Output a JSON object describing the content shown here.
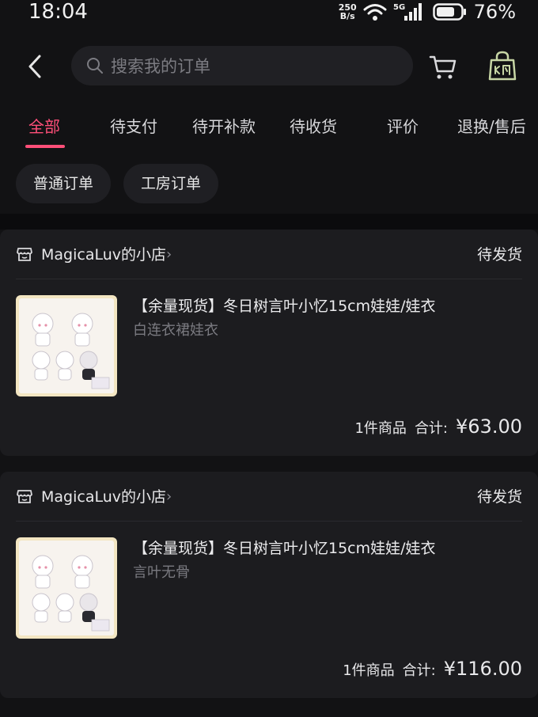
{
  "status_bar": {
    "time": "18:04",
    "net_speed_value": "250",
    "net_speed_unit": "B/s",
    "network_type": "5G",
    "battery_percent": "76%"
  },
  "header": {
    "search_placeholder": "搜索我的订单"
  },
  "tabs": [
    {
      "label": "全部",
      "active": true
    },
    {
      "label": "待支付",
      "active": false
    },
    {
      "label": "待开补款",
      "active": false
    },
    {
      "label": "待收货",
      "active": false
    },
    {
      "label": "评价",
      "active": false
    },
    {
      "label": "退换/售后",
      "active": false
    }
  ],
  "filters": [
    {
      "label": "普通订单"
    },
    {
      "label": "工房订单"
    }
  ],
  "orders": [
    {
      "shop_name": "MagicaLuv的小店",
      "status": "待发货",
      "product_title": "【余量现货】冬日树言叶小忆15cm娃娃/娃衣",
      "product_variant": "白连衣裙娃衣",
      "item_count": "1件商品",
      "total_label": "合计:",
      "total_amount": "¥63.00"
    },
    {
      "shop_name": "MagicaLuv的小店",
      "status": "待发货",
      "product_title": "【余量现货】冬日树言叶小忆15cm娃娃/娃衣",
      "product_variant": "言叶无骨",
      "item_count": "1件商品",
      "total_label": "合计:",
      "total_amount": "¥116.00"
    }
  ],
  "colors": {
    "background": "#121214",
    "card": "#1c1c1f",
    "accent": "#ff4f79",
    "muted_text": "#7a7a80"
  },
  "icons": [
    "back-arrow-icon",
    "search-icon",
    "cart-icon",
    "shopping-bag-icon",
    "shop-icon",
    "chevron-right-icon",
    "wifi-icon",
    "signal-icon",
    "battery-icon"
  ]
}
